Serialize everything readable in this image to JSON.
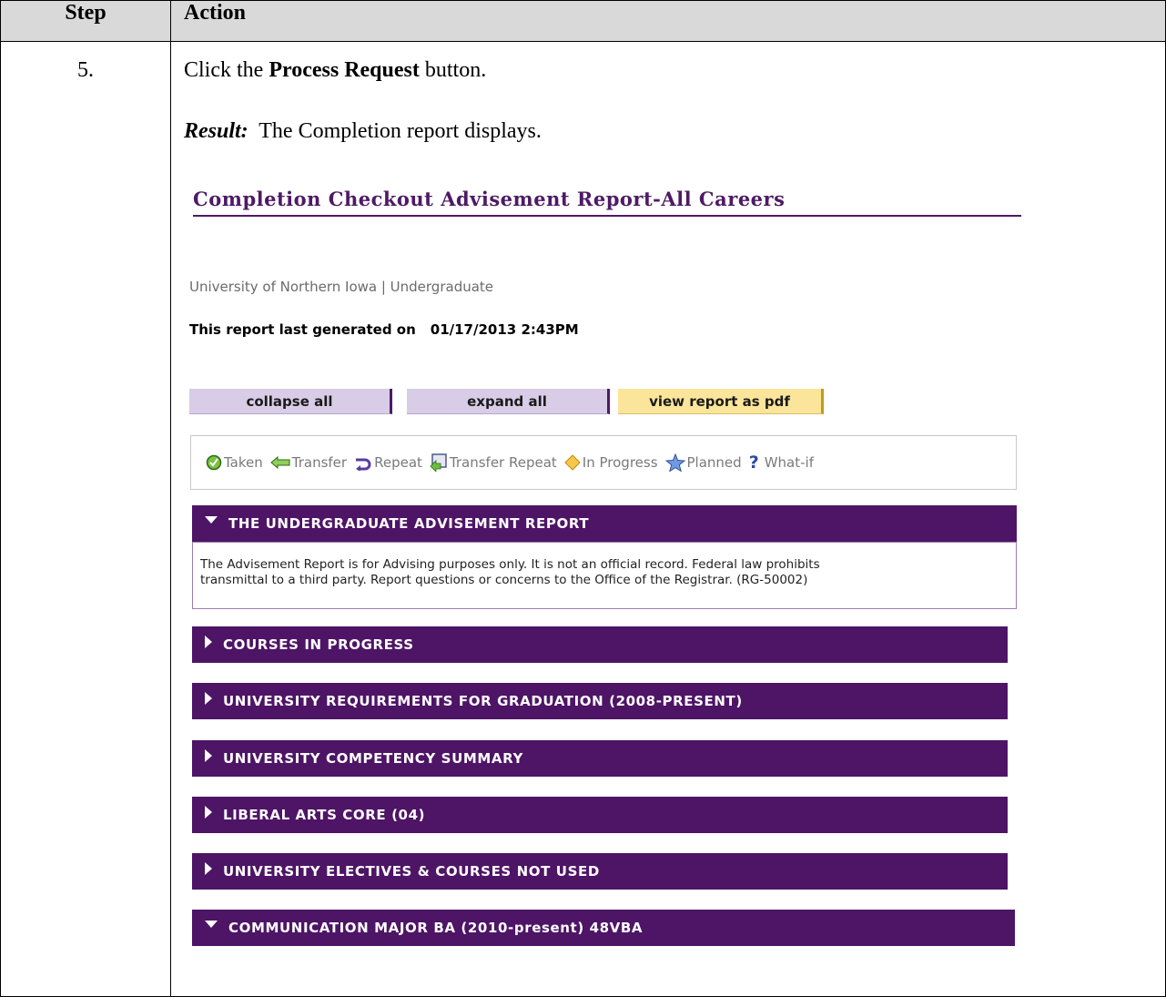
{
  "table": {
    "header_step": "Step",
    "header_action": "Action",
    "step_number": "5.",
    "instruction_prefix": "Click the ",
    "instruction_bold": "Process Request",
    "instruction_suffix": " button.",
    "result_label": "Result:",
    "result_text": "The Completion report displays."
  },
  "report": {
    "title": "Completion Checkout Advisement Report-All Careers",
    "institution": "University of Northern Iowa | Undergraduate",
    "generated_label": "This report last generated on",
    "generated_datetime": "01/17/2013  2:43PM",
    "buttons": {
      "collapse": "collapse all",
      "expand": "expand all",
      "pdf": "view report as pdf"
    },
    "legend": {
      "taken": "Taken",
      "transfer": "Transfer",
      "repeat": "Repeat",
      "transfer_repeat": "Transfer Repeat",
      "in_progress": "In Progress",
      "planned": "Planned",
      "what_if": "What-if"
    },
    "sections": [
      {
        "label": "THE UNDERGRADUATE ADVISEMENT REPORT",
        "expanded": true
      },
      {
        "label": "COURSES IN PROGRESS",
        "expanded": false
      },
      {
        "label": "UNIVERSITY REQUIREMENTS FOR GRADUATION (2008-PRESENT)",
        "expanded": false
      },
      {
        "label": "UNIVERSITY COMPETENCY SUMMARY",
        "expanded": false
      },
      {
        "label": "LIBERAL ARTS CORE (04)",
        "expanded": false
      },
      {
        "label": "UNIVERSITY ELECTIVES & COURSES NOT USED",
        "expanded": false
      },
      {
        "label": "COMMUNICATION MAJOR BA (2010-present) 48VBA",
        "expanded": true
      }
    ],
    "notice_line1": "The Advisement Report is for Advising purposes only. It is not an official record. Federal law prohibits",
    "notice_line2": "transmittal to a third party. Report questions or concerns to the Office of the Registrar. (RG-50002)"
  },
  "colors": {
    "section_purple": "#4e1466",
    "button_lavender": "#d8cce6",
    "button_yellow": "#fbe59a",
    "title_purple": "#4e1a66"
  }
}
